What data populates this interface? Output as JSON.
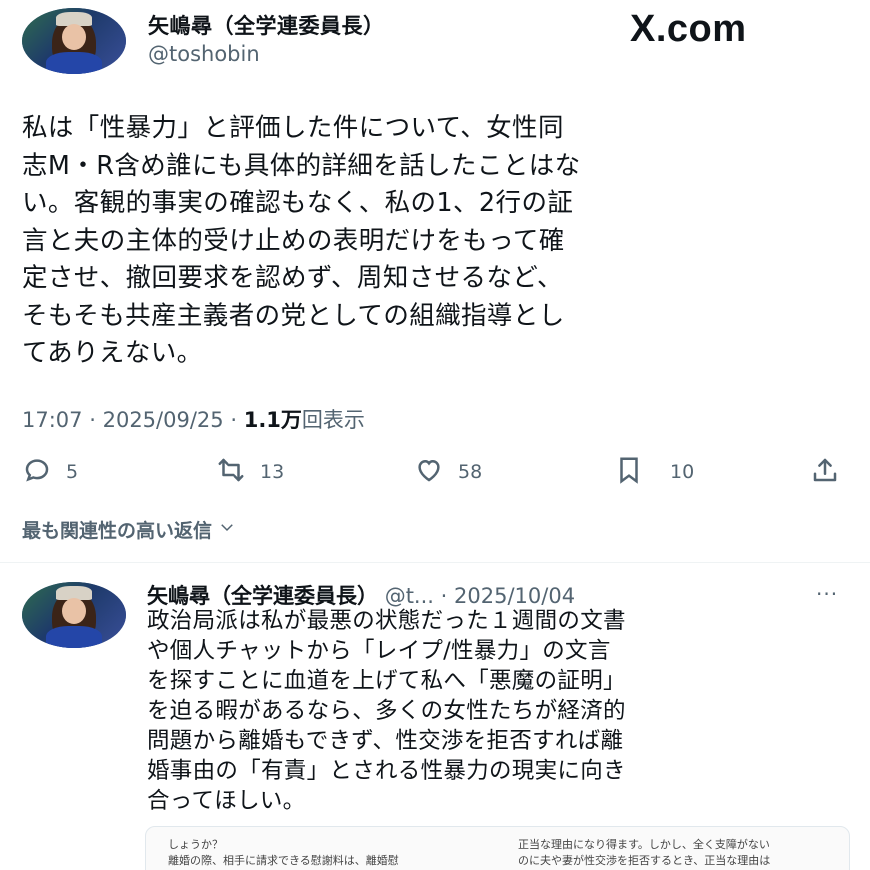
{
  "post": {
    "author_name": "矢嶋尋（全学連委員長）",
    "author_handle": "@toshobin",
    "site_logo": "X.com",
    "body_lines": [
      "私は「性暴力」と評価した件について、女性同",
      "志M・R含め誰にも具体的詳細を話したことはな",
      "い。客観的事実の確認もなく、私の1、2行の証",
      "言と夫の主体的受け止めの表明だけをもって確",
      "定させ、撤回要求を認めず、周知させるなど、",
      "そもそも共産主義者の党としての組織指導とし",
      "てありえない。"
    ],
    "time": "17:07",
    "date": "2025/09/25",
    "views_count": "1.1万",
    "views_label": "回表示",
    "separator": "·"
  },
  "actions": {
    "reply_count": "5",
    "repost_count": "13",
    "like_count": "58",
    "bookmark_count": "10"
  },
  "icons": [
    "reply-icon",
    "repost-icon",
    "like-icon",
    "bookmark-icon",
    "share-icon",
    "chevron-down-icon",
    "more-icon"
  ],
  "replies_sort_label": "最も関連性の高い返信",
  "reply": {
    "author_name": "矢嶋尋（全学連委員長）",
    "handle_truncated": "@t...",
    "date": "2025/10/04",
    "more": "···",
    "body_lines": [
      "政治局派は私が最悪の状態だった１週間の文書",
      "や個人チャットから「レイプ/性暴力」の文言",
      "を探すことに血道を上げて私へ「悪魔の証明」",
      "を迫る暇があるなら、多くの女性たちが経済的",
      "問題から離婚もできず、性交渉を拒否すれば離",
      "婚事由の「有責」とされる性暴力の現実に向き",
      "合ってほしい。"
    ],
    "embed_left_lines": [
      "しょうか？",
      "離婚の際、相手に請求できる慰謝料は、離婚慰"
    ],
    "embed_right_lines": [
      "正当な理由になり得ます。しかし、全く支障がない",
      "のに夫や妻が性交渉を拒否するとき、正当な理由は"
    ]
  },
  "colors": {
    "text": "#0f1419",
    "secondary": "#536471",
    "divider": "#eff3f4"
  }
}
